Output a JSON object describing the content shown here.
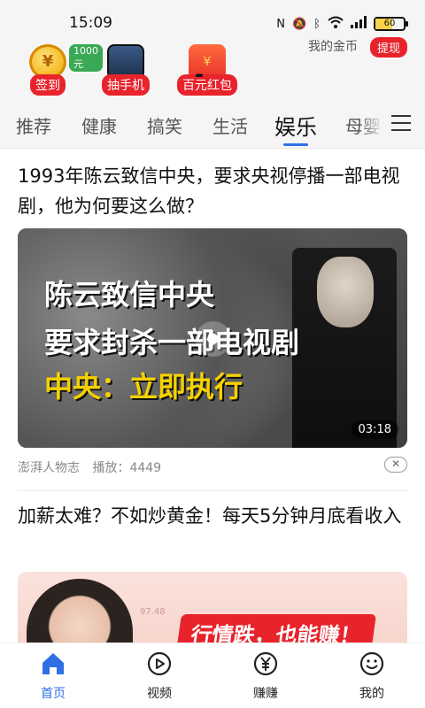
{
  "status_bar": {
    "time": "15:09",
    "battery": "60",
    "icons": [
      "nfc-icon",
      "mute-icon",
      "bluetooth-icon",
      "wifi-icon",
      "signal-icon",
      "battery-icon"
    ]
  },
  "rewards": {
    "items": [
      {
        "label": "签到",
        "bubble": "1000元",
        "icon": "coin-icon",
        "art": "¥"
      },
      {
        "label": "抽手机",
        "icon": "phone-icon"
      },
      {
        "label": "百元红包",
        "icon": "red-envelope-icon",
        "art": "¥"
      }
    ],
    "coins_label": "我的金币",
    "coins_value": "-",
    "withdraw_label": "提现"
  },
  "tabs": {
    "items": [
      "推荐",
      "健康",
      "搞笑",
      "生活",
      "娱乐",
      "母婴"
    ],
    "active": "娱乐"
  },
  "feed": {
    "articles": [
      {
        "title": "1993年陈云致信中央，要求央视停播一部电视剧，他为何要这么做？",
        "video_text": [
          "陈云致信中央",
          "要求封杀一部电视剧",
          "中央：立即执行"
        ],
        "duration": "03:18",
        "source": "澎湃人物志",
        "plays": "播放：4449"
      },
      {
        "title": "加薪太难？不如炒黄金！每天5分钟月底看收入",
        "ad_banner": "行情跌，也能赚！",
        "ad_number": "97.48"
      }
    ]
  },
  "bottom_nav": {
    "items": [
      {
        "label": "首页",
        "icon": "home-icon"
      },
      {
        "label": "视频",
        "icon": "video-play-icon"
      },
      {
        "label": "赚赚",
        "icon": "yen-coin-icon"
      },
      {
        "label": "我的",
        "icon": "smiley-profile-icon"
      }
    ],
    "active": "首页"
  },
  "colors": {
    "accent": "#2f6fe6",
    "brand_red": "#e8232c",
    "highlight_yellow": "#f6d100"
  }
}
